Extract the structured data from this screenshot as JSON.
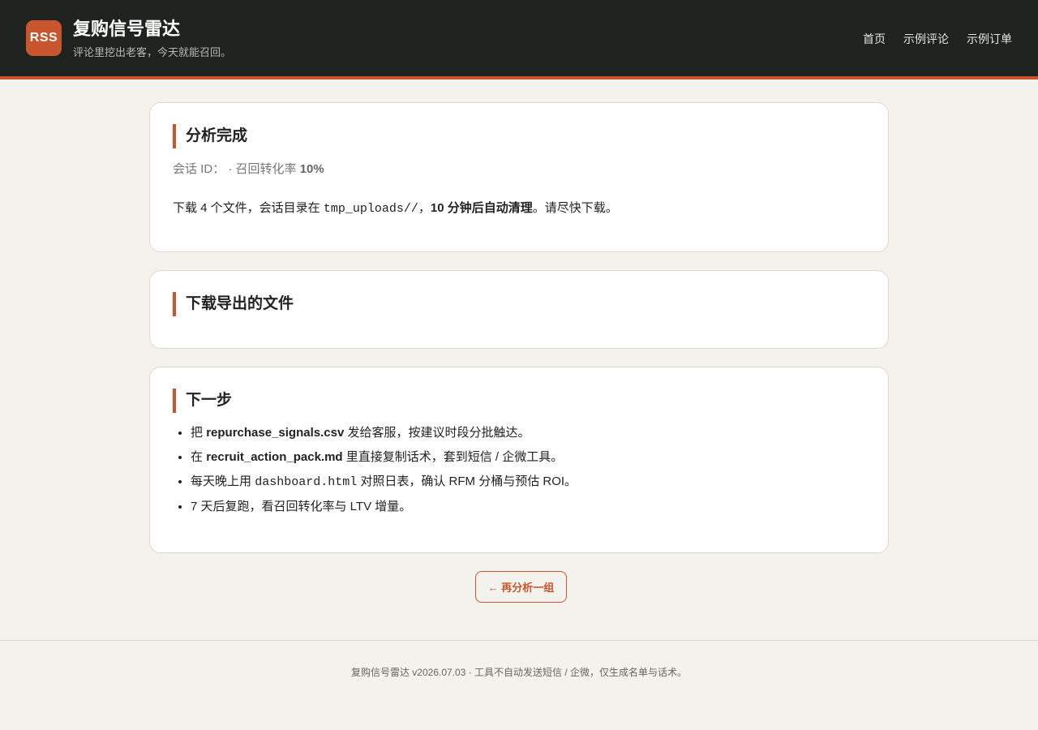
{
  "header": {
    "logo_text": "RSS",
    "title": "复购信号雷达",
    "subtitle": "评论里挖出老客，今天就能召回。",
    "nav": [
      "首页",
      "示例评论",
      "示例订单"
    ]
  },
  "analysis": {
    "title": "分析完成",
    "session_label": "会话 ID：",
    "separator": "·",
    "rate_label": "召回转化率",
    "rate_value": "10%",
    "notice_prefix": "下载 4 个文件，会话目录在",
    "notice_dir": "tmp_uploads//",
    "notice_comma": "，",
    "notice_bold": "10 分钟后自动清理",
    "notice_suffix": "。请尽快下载。"
  },
  "downloads": {
    "title": "下载导出的文件"
  },
  "next_steps": {
    "title": "下一步",
    "step1": {
      "a": "把",
      "b": "repurchase_signals.csv",
      "c": "发给客服，按建议时段分批触达。"
    },
    "step2": {
      "a": "在",
      "b": "recruit_action_pack.md",
      "c": "里直接复制话术，套到短信 / 企微工具。"
    },
    "step3": {
      "a": "每天晚上用",
      "b": "dashboard.html",
      "c": "对照日表，确认 RFM 分桶与预估 ROI。"
    },
    "step4": "7 天后复跑，看召回转化率与 LTV 增量。"
  },
  "actions": {
    "reanalyze": "← 再分析一组"
  },
  "footer": {
    "text": "复购信号雷达 v2026.07.03 · 工具不自动发送短信 / 企微，仅生成名单与话术。"
  },
  "colors": {
    "accent": "#c8552e",
    "header_bg": "#1f2320",
    "page_bg": "#f4f2ed"
  }
}
